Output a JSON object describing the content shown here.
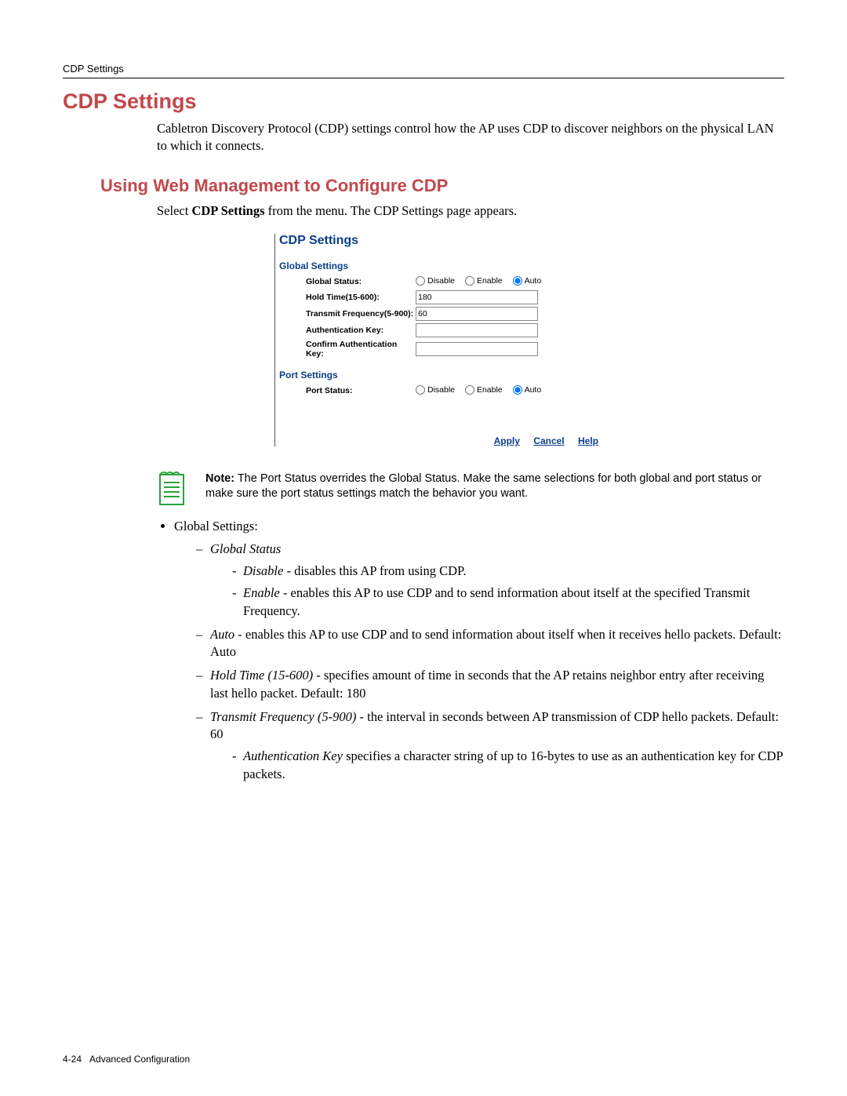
{
  "header": {
    "running": "CDP Settings"
  },
  "section": {
    "title": "CDP Settings",
    "intro": "Cabletron Discovery Protocol (CDP) settings control how the AP uses CDP to discover neighbors on the physical LAN to which it connects."
  },
  "subsection": {
    "title": "Using Web Management to Configure CDP",
    "lead_pre": "Select ",
    "lead_bold": "CDP Settings",
    "lead_post": " from the menu. The CDP Settings page appears."
  },
  "panel": {
    "title": "CDP Settings",
    "global_heading": "Global Settings",
    "port_heading": "Port Settings",
    "rows": {
      "global_status": "Global Status:",
      "hold_time": "Hold Time(15-600):",
      "transmit_freq": "Transmit Frequency(5-900):",
      "auth_key": "Authentication Key:",
      "confirm_auth_key": "Confirm Authentication Key:",
      "port_status": "Port Status:"
    },
    "radios": {
      "disable": "Disable",
      "enable": "Enable",
      "auto": "Auto"
    },
    "values": {
      "hold_time": "180",
      "transmit_freq": "60",
      "auth_key": "",
      "confirm_auth_key": ""
    },
    "selected": {
      "global_status": "auto",
      "port_status": "auto"
    },
    "footer": {
      "apply": "Apply",
      "cancel": "Cancel",
      "help": "Help"
    }
  },
  "note": {
    "prefix": "Note:",
    "text": " The Port Status overrides the Global Status. Make the same selections for both global and port status or make sure the port status settings match the behavior you want."
  },
  "bullets": {
    "top_label": "Global Settings:",
    "items": {
      "global_status_label": "Global Status",
      "disable_label": "Disable",
      "disable_text": " - disables this AP from using CDP.",
      "enable_label": "Enable",
      "enable_text": " - enables this AP to use CDP and to send information about itself at the specified Transmit Frequency.",
      "auto_label": "Auto",
      "auto_text": " - enables this AP to use CDP and to send information about itself when it receives hello packets. Default: Auto",
      "hold_label": "Hold Time (15-600)",
      "hold_text": " - specifies amount of time in seconds that the AP retains neighbor entry after receiving last hello packet. Default: 180",
      "tx_label": "Transmit Frequency (5-900)",
      "tx_text": " - the interval in seconds between AP transmission of CDP hello packets. Default: 60",
      "authkey_label": "Authentication Key",
      "authkey_text": " specifies a character string of up to 16-bytes to use as an authentication key for CDP packets."
    }
  },
  "footer": {
    "page": "4-24",
    "chapter": "Advanced Configuration"
  }
}
